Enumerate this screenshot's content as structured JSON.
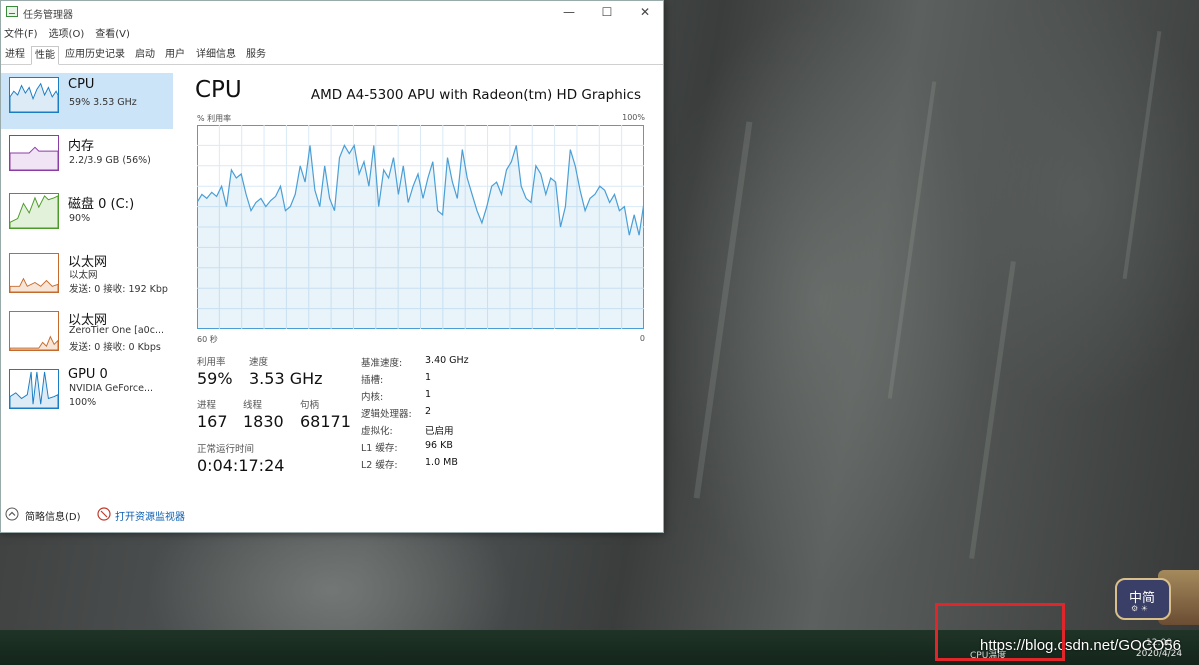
{
  "window": {
    "title": "任务管理器",
    "controls": {
      "minimize": "—",
      "maximize": "☐",
      "close": "✕"
    }
  },
  "menu": [
    "文件(F)",
    "选项(O)",
    "查看(V)"
  ],
  "tabs": [
    {
      "label": "进程",
      "active": false
    },
    {
      "label": "性能",
      "active": true
    },
    {
      "label": "应用历史记录",
      "active": false
    },
    {
      "label": "启动",
      "active": false
    },
    {
      "label": "用户",
      "active": false
    },
    {
      "label": "详细信息",
      "active": false
    },
    {
      "label": "服务",
      "active": false
    }
  ],
  "sidebar": [
    {
      "name": "CPU",
      "line1": "59% 3.53 GHz",
      "line2": "",
      "line3": "",
      "color": "#1a7dc4",
      "selected": true
    },
    {
      "name": "内存",
      "line1": "2.2/3.9 GB (56%)",
      "line2": "",
      "line3": "",
      "color": "#8b3ca6",
      "selected": false
    },
    {
      "name": "磁盘 0 (C:)",
      "line1": "90%",
      "line2": "",
      "line3": "",
      "color": "#4c9a2a",
      "selected": false
    },
    {
      "name": "以太网",
      "line1": "以太网",
      "line2": "发送: 0 接收: 192 Kbp",
      "line3": "",
      "color": "#c56a2c",
      "selected": false
    },
    {
      "name": "以太网",
      "line1": "ZeroTier One [a0c...",
      "line2": "发送: 0 接收: 0 Kbps",
      "line3": "",
      "color": "#c56a2c",
      "selected": false
    },
    {
      "name": "GPU 0",
      "line1": "NVIDIA GeForce...",
      "line2": "100%",
      "line3": "",
      "color": "#1a7dc4",
      "selected": false
    }
  ],
  "main": {
    "title": "CPU",
    "model": "AMD A4-5300 APU with Radeon(tm) HD Graphics",
    "axis_left_top": "% 利用率",
    "axis_right_top": "100%",
    "axis_left_bottom": "60 秒",
    "axis_right_bottom": "0",
    "graph_color": "#4a9fd6",
    "usage_history": [
      62,
      66,
      64,
      67,
      65,
      70,
      60,
      78,
      74,
      76,
      66,
      58,
      62,
      64,
      60,
      63,
      65,
      70,
      58,
      60,
      66,
      80,
      72,
      90,
      68,
      60,
      80,
      64,
      58,
      84,
      90,
      86,
      90,
      76,
      82,
      70,
      90,
      60,
      78,
      74,
      84,
      66,
      80,
      62,
      70,
      76,
      64,
      74,
      82,
      58,
      56,
      84,
      72,
      64,
      88,
      74,
      66,
      58,
      52,
      60,
      70,
      72,
      66,
      78,
      82,
      90,
      70,
      64,
      62,
      80,
      76,
      66,
      74,
      72,
      50,
      60,
      88,
      80,
      68,
      58,
      64,
      66,
      70,
      68,
      62,
      66,
      58,
      60,
      46,
      56,
      46,
      62
    ],
    "stats": {
      "usage_label": "利用率",
      "usage_value": "59%",
      "speed_label": "速度",
      "speed_value": "3.53 GHz",
      "process_label": "进程",
      "process_value": "167",
      "thread_label": "线程",
      "thread_value": "1830",
      "handle_label": "句柄",
      "handle_value": "68171",
      "uptime_label": "正常运行时间",
      "uptime_value": "0:04:17:24"
    },
    "specs": [
      {
        "label": "基准速度:",
        "value": "3.40 GHz"
      },
      {
        "label": "插槽:",
        "value": "1"
      },
      {
        "label": "内核:",
        "value": "1"
      },
      {
        "label": "逻辑处理器:",
        "value": "2"
      },
      {
        "label": "虚拟化:",
        "value": "已启用"
      },
      {
        "label": "L1 缓存:",
        "value": "96 KB"
      },
      {
        "label": "L2 缓存:",
        "value": "1.0 MB"
      }
    ]
  },
  "footer": {
    "summary": "简略信息(D)",
    "resource_monitor": "打开资源监视器"
  },
  "tray": {
    "ime_main": "中简",
    "ime_sub": "⚙ ☀",
    "label": "CPU温度",
    "time": "12:00",
    "date": "2020/4/24"
  },
  "watermark": "https://blog.csdn.net/GOCO56",
  "accent_highlight": "#e0262b"
}
